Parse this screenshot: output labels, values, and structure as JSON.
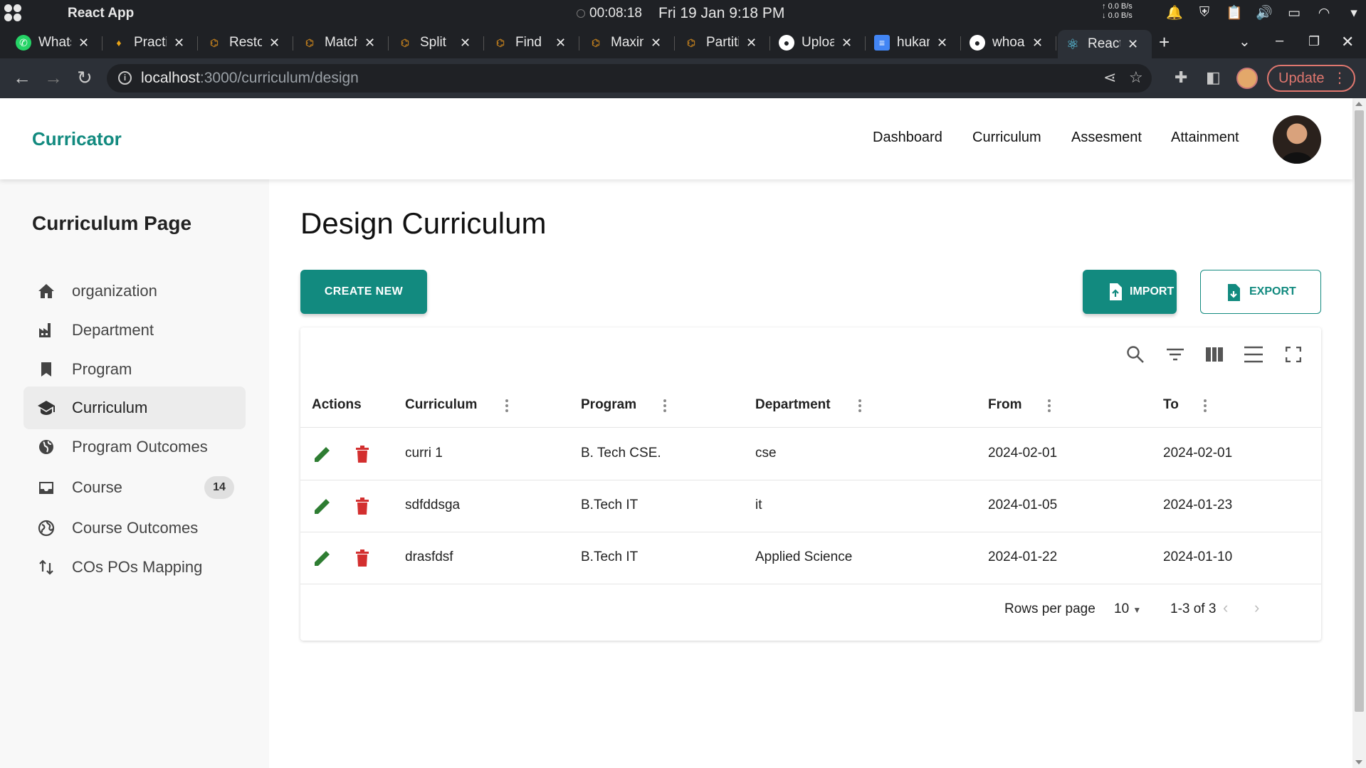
{
  "os": {
    "app_name": "React App",
    "timer": "00:08:18",
    "clock": "Fri 19 Jan  9:18 PM",
    "net_up": "0.0 B/s",
    "net_down": "0.0 B/s"
  },
  "browser": {
    "tabs": [
      {
        "title": "WhatsApp",
        "favicon": "whatsapp-icon",
        "color": "#25d366"
      },
      {
        "title": "Practice",
        "favicon": "bell-icon",
        "color": "#e8a317"
      },
      {
        "title": "Restore",
        "favicon": "leetcode-icon",
        "color": "#f89f1b"
      },
      {
        "title": "Match",
        "favicon": "leetcode-icon",
        "color": "#f89f1b"
      },
      {
        "title": "Split",
        "favicon": "leetcode-icon",
        "color": "#f89f1b"
      },
      {
        "title": "Find",
        "favicon": "leetcode-icon",
        "color": "#f89f1b"
      },
      {
        "title": "Maximum",
        "favicon": "leetcode-icon",
        "color": "#f89f1b"
      },
      {
        "title": "Partition",
        "favicon": "leetcode-icon",
        "color": "#f89f1b"
      },
      {
        "title": "Upload",
        "favicon": "github-icon",
        "color": "#ffffff"
      },
      {
        "title": "hukam",
        "favicon": "docs-icon",
        "color": "#4285f4"
      },
      {
        "title": "whoami",
        "favicon": "github-icon",
        "color": "#ffffff"
      },
      {
        "title": "React App",
        "favicon": "react-icon",
        "color": "#61dafb"
      }
    ],
    "url_host": "localhost",
    "url_path": ":3000/curriculum/design",
    "update_label": "Update"
  },
  "header": {
    "brand": "Curricator",
    "nav": [
      "Dashboard",
      "Curriculum",
      "Assesment",
      "Attainment"
    ],
    "brand_color": "#128a7f"
  },
  "sidebar": {
    "title": "Curriculum Page",
    "items": [
      {
        "label": "organization",
        "icon": "home-icon"
      },
      {
        "label": "Department",
        "icon": "factory-icon"
      },
      {
        "label": "Program",
        "icon": "bookmark-icon"
      },
      {
        "label": "Curriculum",
        "icon": "school-icon",
        "active": true
      },
      {
        "label": "Program Outcomes",
        "icon": "globe-icon"
      },
      {
        "label": "Course",
        "icon": "inbox-icon",
        "badge": "14"
      },
      {
        "label": "Course Outcomes",
        "icon": "public-icon"
      },
      {
        "label": "COs POs Mapping",
        "icon": "swap-vert-icon"
      }
    ]
  },
  "main": {
    "title": "Design Curriculum",
    "create_label": "CREATE NEW",
    "import_label": "IMPORT",
    "export_label": "EXPORT",
    "accent": "#128a7f"
  },
  "table": {
    "columns": [
      "Actions",
      "Curriculum",
      "Program",
      "Department",
      "From",
      "To"
    ],
    "rows": [
      {
        "curriculum": "curri 1",
        "program": "B. Tech CSE.",
        "department": "cse",
        "from": "2024-02-01",
        "to": "2024-02-01"
      },
      {
        "curriculum": "sdfddsga",
        "program": "B.Tech IT",
        "department": "it",
        "from": "2024-01-05",
        "to": "2024-01-23"
      },
      {
        "curriculum": "drasfdsf",
        "program": "B.Tech IT",
        "department": "Applied Science",
        "from": "2024-01-22",
        "to": "2024-01-10"
      }
    ],
    "rows_per_page_label": "Rows per page",
    "rows_per_page": "10",
    "range": "1-3 of 3",
    "edit_color": "#2e7d32",
    "delete_color": "#d32f2f"
  }
}
